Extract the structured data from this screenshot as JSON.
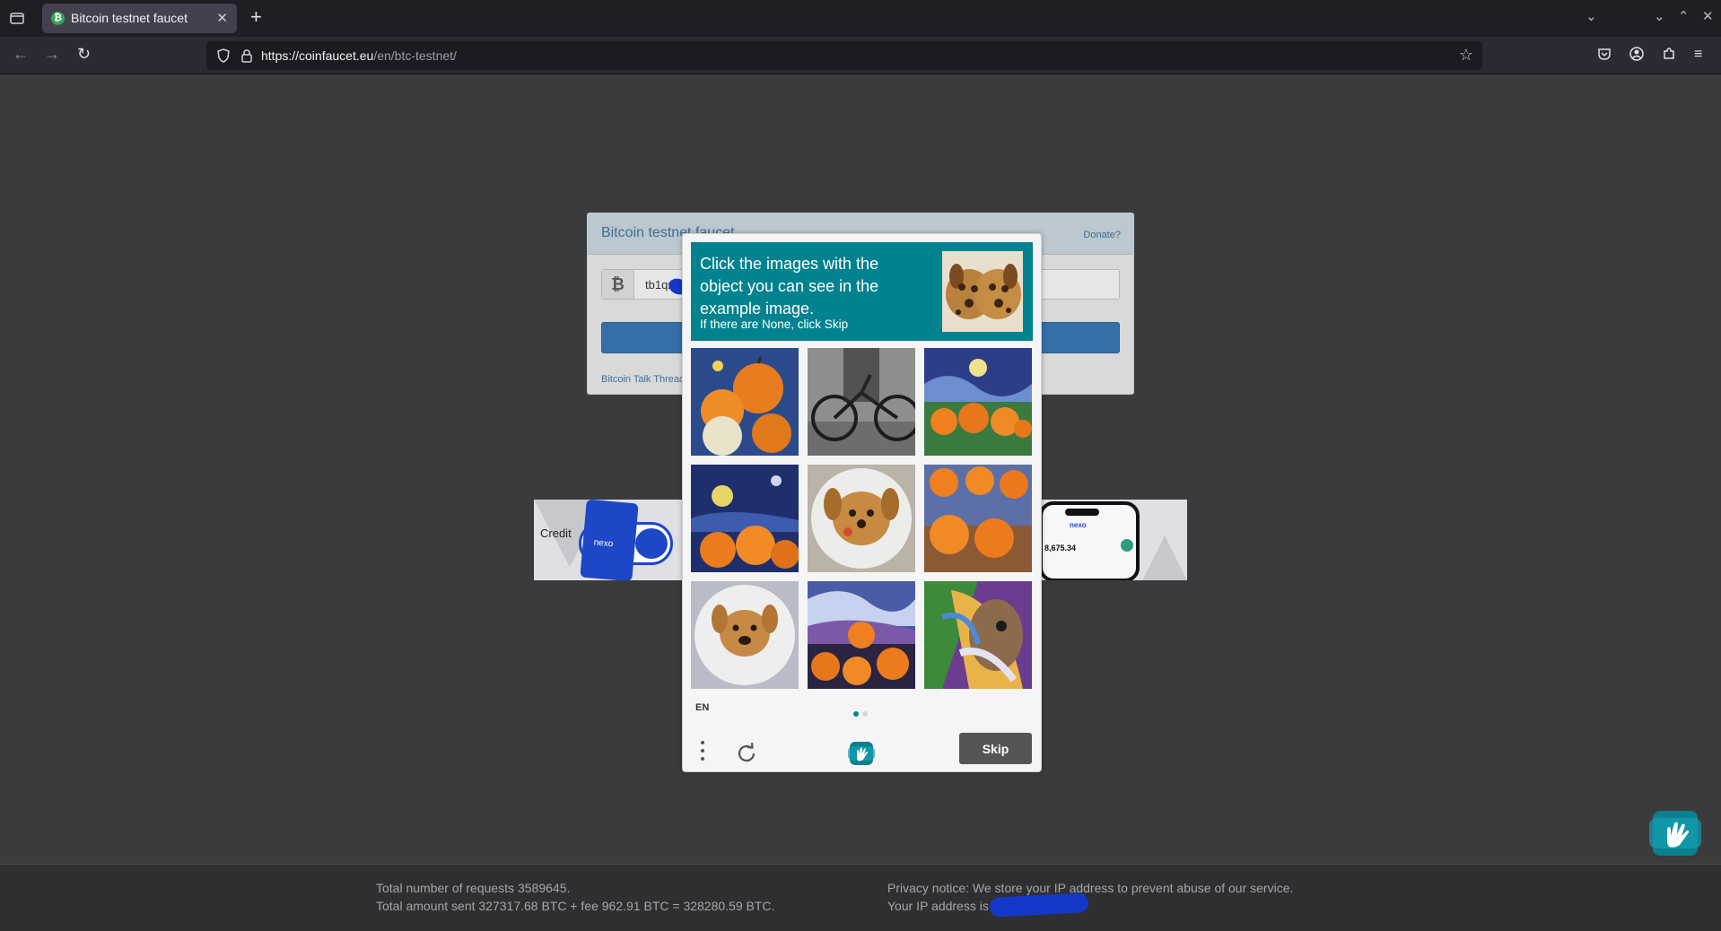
{
  "browser": {
    "tab_title": "Bitcoin testnet faucet",
    "tab_favicon": "₿",
    "tab_close": "✕",
    "new_tab": "+",
    "url_host": "https://coinfaucet.eu",
    "url_path": "/en/btc-testnet/"
  },
  "faucet": {
    "title": "Bitcoin testnet faucet",
    "donate_link": "Donate?",
    "currency_symbol": "₿",
    "address_value": "tb1qx4",
    "talk_link": "Bitcoin Talk Thread"
  },
  "ad": {
    "credit_label": "Credit",
    "card_brand": "nexo",
    "phone_brand": "nexo",
    "phone_amount": "8,675.34"
  },
  "captcha": {
    "instruction": "Click the images with the object you can see in the example image.",
    "sub_instruction": "If there are None, click Skip",
    "language": "EN",
    "skip_label": "Skip",
    "page_count": 2,
    "current_page": 1,
    "tiles": [
      {
        "subject": "pumpkins-starry"
      },
      {
        "subject": "bicycle"
      },
      {
        "subject": "pumpkins-starry-night"
      },
      {
        "subject": "pumpkins-night-sky"
      },
      {
        "subject": "dog-cookie-on-plate"
      },
      {
        "subject": "pumpkins-on-table"
      },
      {
        "subject": "dog-cookie-on-plate"
      },
      {
        "subject": "pumpkins-swirl-sky"
      },
      {
        "subject": "squirrel-painting"
      }
    ],
    "example_subject": "dog-shaped-cookies"
  },
  "footer": {
    "requests_text": "Total number of requests 3589645.",
    "amount_text": "Total amount sent 327317.68 BTC + fee 962.91 BTC = 328280.59 BTC.",
    "privacy_text": "Privacy notice: We store your IP address to prevent abuse of our service.",
    "ip_text": "Your IP address is"
  },
  "colors": {
    "captcha_prompt_bg": "#00838f",
    "submit_button": "#346fa9",
    "link": "#3d6f94",
    "page_bg": "#3b3b3e"
  }
}
